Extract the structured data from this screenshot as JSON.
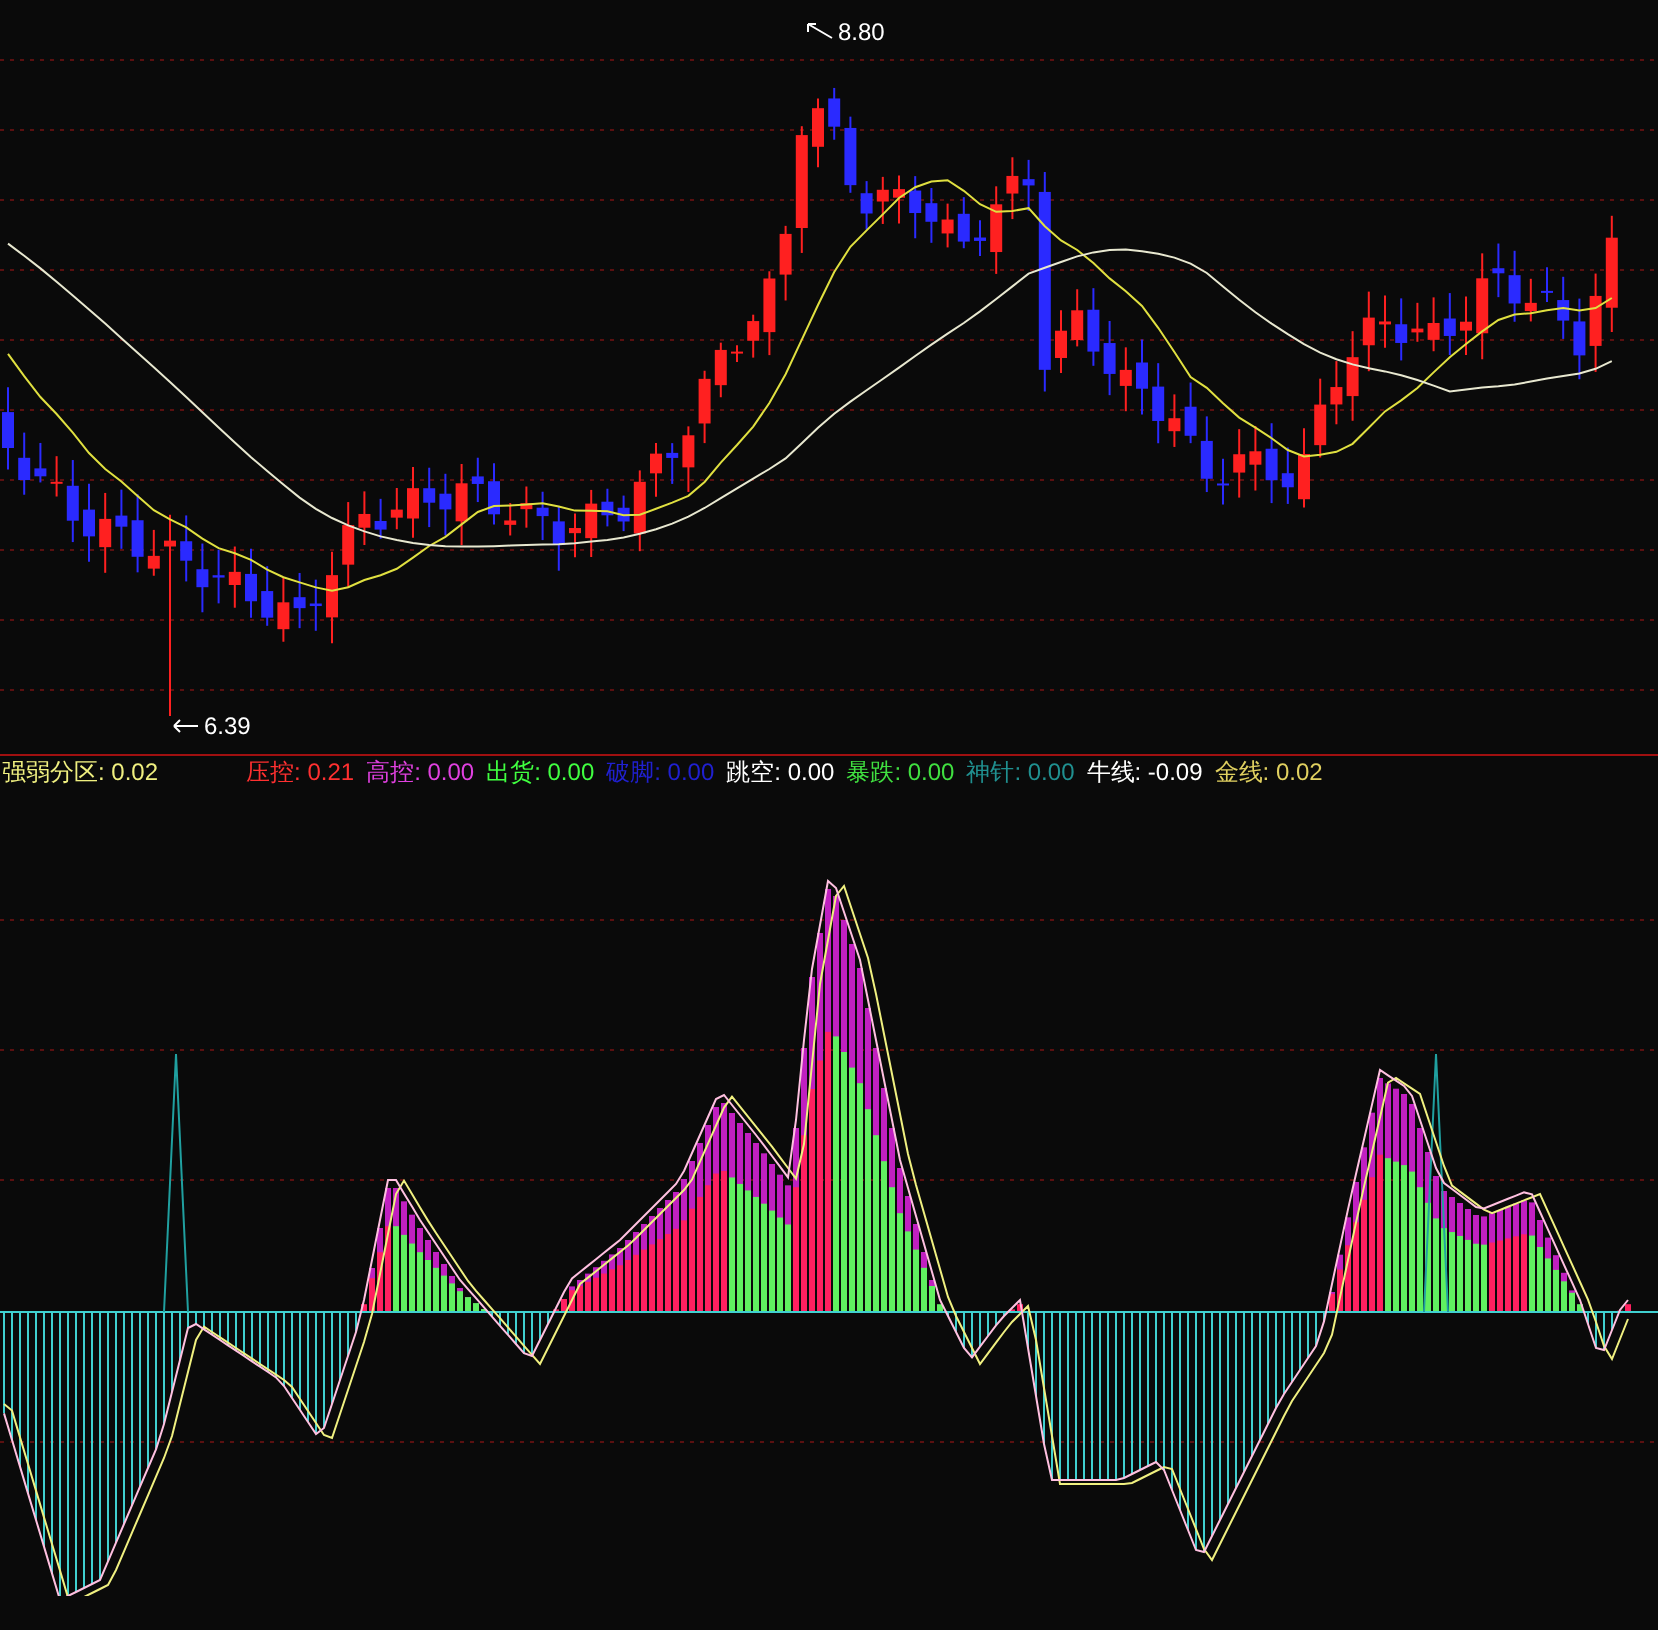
{
  "price_panel": {
    "high_marker": {
      "value": "8.80"
    },
    "low_marker": {
      "value": "6.39"
    }
  },
  "indicator_panel": {
    "legend": [
      {
        "label": "强弱分区:",
        "value": "0.02",
        "color": "#f0f080"
      },
      {
        "label": "压控:",
        "value": "0.21",
        "color": "#ff3030"
      },
      {
        "label": "高控:",
        "value": "0.00",
        "color": "#e040e0"
      },
      {
        "label": "出货:",
        "value": "0.00",
        "color": "#40ff40"
      },
      {
        "label": "破脚:",
        "value": "0.00",
        "color": "#2020d0"
      },
      {
        "label": "跳空:",
        "value": "0.00",
        "color": "#ffffff"
      },
      {
        "label": "暴跌:",
        "value": "0.00",
        "color": "#40e040"
      },
      {
        "label": "神针:",
        "value": "0.00",
        "color": "#209090"
      },
      {
        "label": "牛线:",
        "value": "-0.09",
        "color": "#fffffe"
      },
      {
        "label": "金线:",
        "value": "0.02",
        "color": "#e0d060"
      }
    ]
  }
}
